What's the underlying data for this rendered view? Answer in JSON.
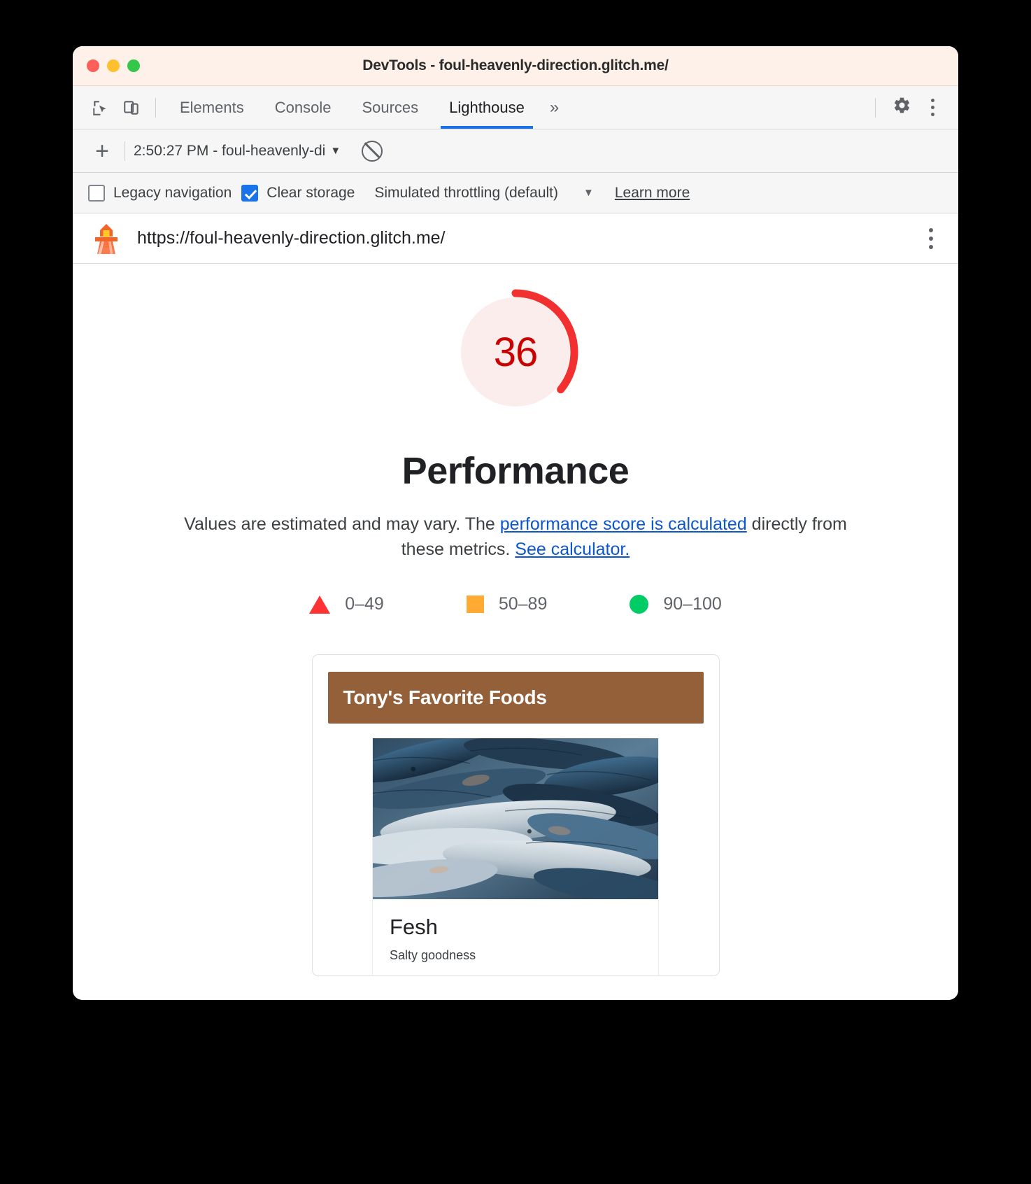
{
  "window": {
    "title": "DevTools - foul-heavenly-direction.glitch.me/",
    "traffic_lights": [
      "close",
      "minimize",
      "zoom"
    ]
  },
  "devtools_tabs": {
    "inspect_icon": "inspect-cursor-icon",
    "device_icon": "device-toolbar-icon",
    "items": [
      {
        "label": "Elements",
        "active": false
      },
      {
        "label": "Console",
        "active": false
      },
      {
        "label": "Sources",
        "active": false
      },
      {
        "label": "Lighthouse",
        "active": true
      }
    ],
    "more_tabs": "»",
    "settings_icon": "gear-icon",
    "menu_icon": "kebab-menu-icon"
  },
  "run_bar": {
    "add_label": "+",
    "report_selected": "2:50:27 PM - foul-heavenly-di",
    "caret": "▼",
    "clear_icon": "no-entry-icon"
  },
  "options_bar": {
    "legacy_navigation": {
      "label": "Legacy navigation",
      "checked": false
    },
    "clear_storage": {
      "label": "Clear storage",
      "checked": true
    },
    "throttling": {
      "label": "Simulated throttling (default)",
      "caret": "▼"
    },
    "learn_more": "Learn more"
  },
  "url_bar": {
    "logo": "lighthouse-logo-icon",
    "url": "https://foul-heavenly-direction.glitch.me/",
    "menu_icon": "kebab-menu-icon"
  },
  "report": {
    "score": "36",
    "score_value": 36,
    "score_color": "#cc0000",
    "gauge_track_color": "#fceded",
    "gauge_arc_color": "#f23030",
    "category_title": "Performance",
    "description_before": "Values are estimated and may vary. The ",
    "description_link1": "performance score is calculated",
    "description_middle": " directly from these metrics. ",
    "description_link2": "See calculator.",
    "link_color": "#0b57d0",
    "legend": [
      {
        "shape": "triangle",
        "color": "#ff3333",
        "label": "0–49"
      },
      {
        "shape": "square",
        "color": "#ffaa33",
        "label": "50–89"
      },
      {
        "shape": "circle",
        "color": "#00cc66",
        "label": "90–100"
      }
    ]
  },
  "screenshot_card": {
    "banner_text": "Tony's Favorite Foods",
    "banner_color": "#94603a",
    "food": {
      "image": "fish-photo",
      "title": "Fesh",
      "subtitle": "Salty goodness"
    }
  }
}
